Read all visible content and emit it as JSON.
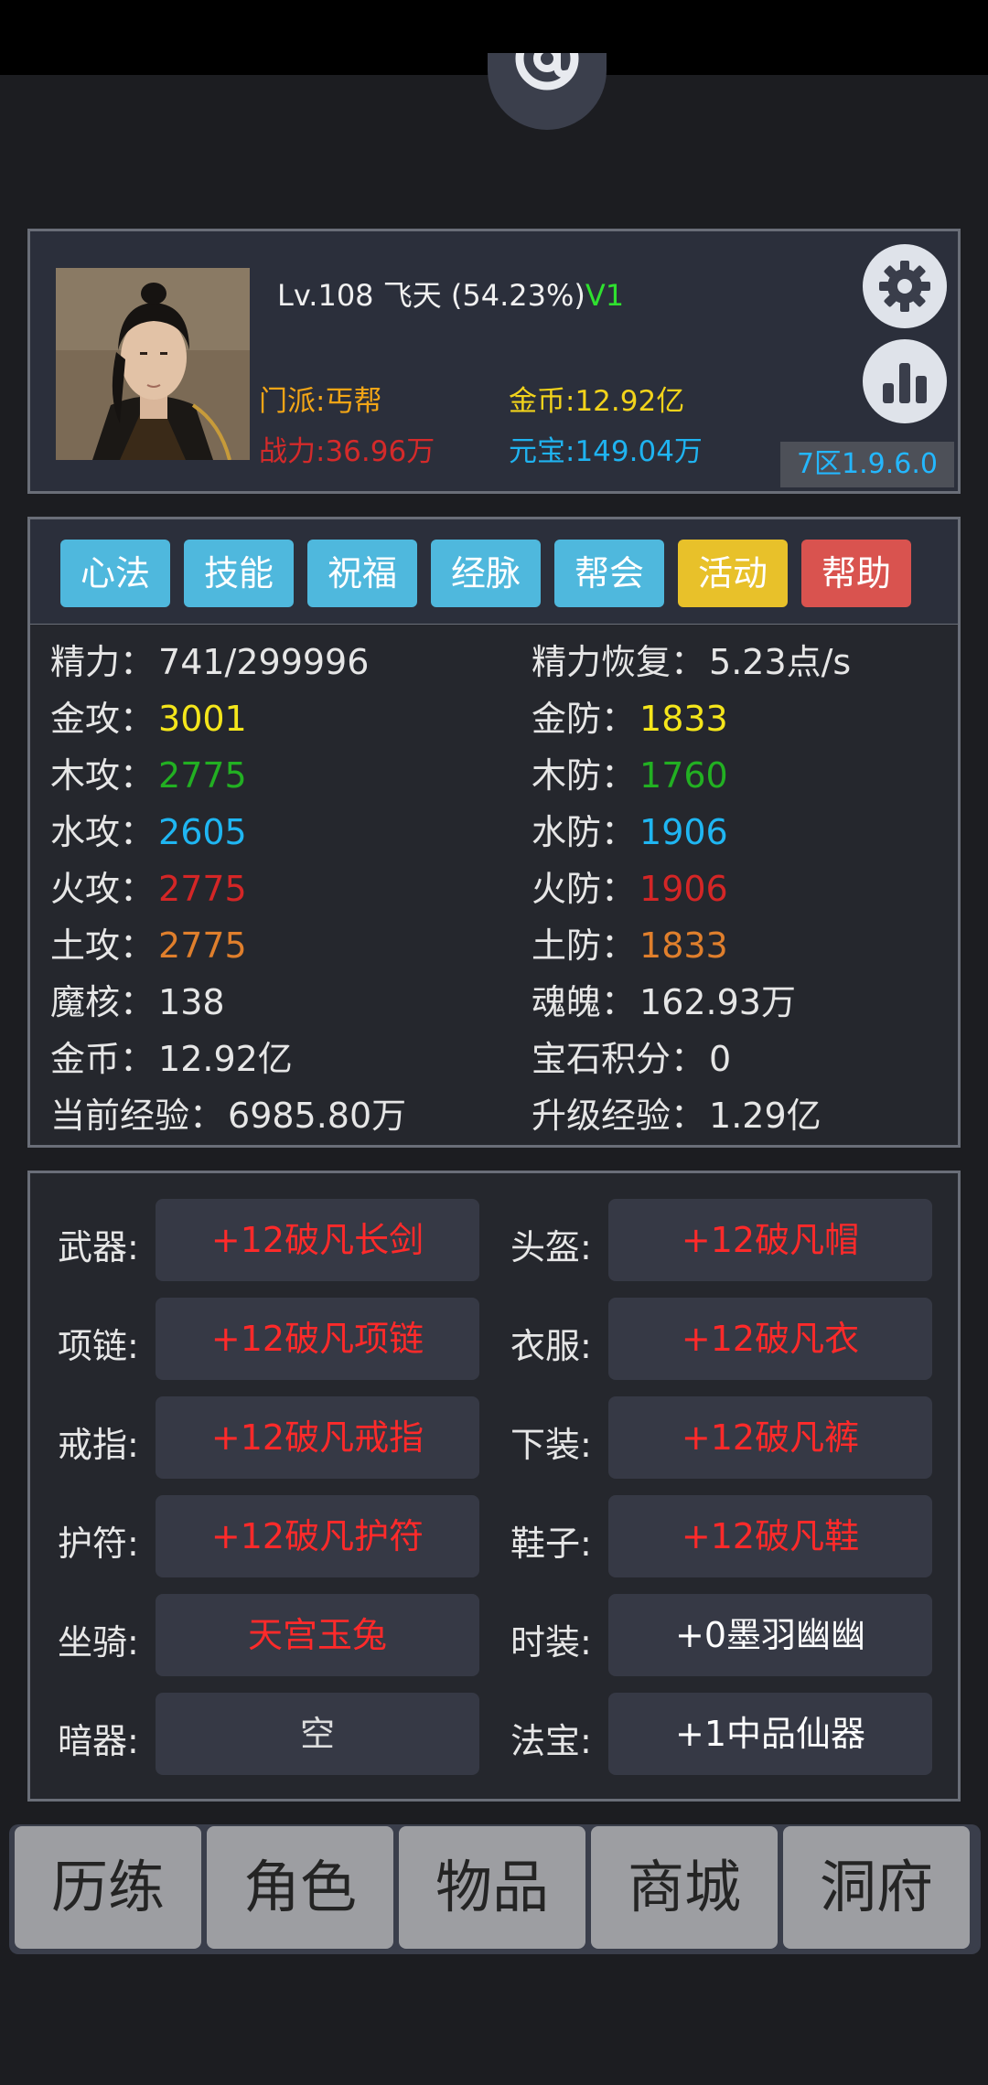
{
  "profile": {
    "level": "Lv.108",
    "name": "飞天",
    "progress": "(54.23%)",
    "vip": "V1",
    "sect": "门派:丐帮",
    "power": "战力:36.96万",
    "gold": "金币:12.92亿",
    "yuanbao": "元宝:149.04万",
    "server": "7区1.9.6.0",
    "icons": [
      "gear-icon",
      "bar-chart-icon",
      "at-icon"
    ]
  },
  "tabs": [
    {
      "label": "心法",
      "color": "#4fb8dd"
    },
    {
      "label": "技能",
      "color": "#4fb8dd"
    },
    {
      "label": "祝福",
      "color": "#4fb8dd"
    },
    {
      "label": "经脉",
      "color": "#4fb8dd"
    },
    {
      "label": "帮会",
      "color": "#4fb8dd"
    },
    {
      "label": "活动",
      "color": "#e8c12a"
    },
    {
      "label": "帮助",
      "color": "#d9534f"
    }
  ],
  "stats": {
    "left": [
      {
        "label": "精力：",
        "value": "741/299996",
        "color": "#e6e6e6"
      },
      {
        "label": "金攻：",
        "value": "3001",
        "color": "#f5e61b"
      },
      {
        "label": "木攻：",
        "value": "2775",
        "color": "#22b022"
      },
      {
        "label": "水攻：",
        "value": "2605",
        "color": "#1fb6f2"
      },
      {
        "label": "火攻：",
        "value": "2775",
        "color": "#d42626"
      },
      {
        "label": "土攻：",
        "value": "2775",
        "color": "#e07f2c"
      },
      {
        "label": "魔核：",
        "value": "138",
        "color": "#e6e6e6"
      },
      {
        "label": "金币：",
        "value": "12.92亿",
        "color": "#e6e6e6"
      },
      {
        "label": "当前经验：",
        "value": "6985.80万",
        "color": "#e6e6e6"
      }
    ],
    "right": [
      {
        "label": "精力恢复：",
        "value": "5.23点/s",
        "color": "#e6e6e6"
      },
      {
        "label": "金防：",
        "value": "1833",
        "color": "#f5e61b"
      },
      {
        "label": "木防：",
        "value": "1760",
        "color": "#22b022"
      },
      {
        "label": "水防：",
        "value": "1906",
        "color": "#1fb6f2"
      },
      {
        "label": "火防：",
        "value": "1906",
        "color": "#d42626"
      },
      {
        "label": "土防：",
        "value": "1833",
        "color": "#e07f2c"
      },
      {
        "label": "魂魄：",
        "value": "162.93万",
        "color": "#e6e6e6"
      },
      {
        "label": "宝石积分：",
        "value": "0",
        "color": "#e6e6e6"
      },
      {
        "label": "升级经验：",
        "value": "1.29亿",
        "color": "#e6e6e6"
      }
    ]
  },
  "equipment": {
    "left": [
      {
        "label": "武器:",
        "item": "+12破凡长剑",
        "color": "#ff2a2a"
      },
      {
        "label": "项链:",
        "item": "+12破凡项链",
        "color": "#ff2a2a"
      },
      {
        "label": "戒指:",
        "item": "+12破凡戒指",
        "color": "#ff2a2a"
      },
      {
        "label": "护符:",
        "item": "+12破凡护符",
        "color": "#ff2a2a"
      },
      {
        "label": "坐骑:",
        "item": "天宫玉兔",
        "color": "#ff2a2a"
      },
      {
        "label": "暗器:",
        "item": "空",
        "color": "#dddddd"
      }
    ],
    "right": [
      {
        "label": "头盔:",
        "item": "+12破凡帽",
        "color": "#ff2a2a"
      },
      {
        "label": "衣服:",
        "item": "+12破凡衣",
        "color": "#ff2a2a"
      },
      {
        "label": "下装:",
        "item": "+12破凡裤",
        "color": "#ff2a2a"
      },
      {
        "label": "鞋子:",
        "item": "+12破凡鞋",
        "color": "#ff2a2a"
      },
      {
        "label": "时装:",
        "item": "+0墨羽幽幽",
        "color": "#ffffff"
      },
      {
        "label": "法宝:",
        "item": "+1中品仙器",
        "color": "#ffffff"
      }
    ]
  },
  "nav": [
    "历练",
    "角色",
    "物品",
    "商城",
    "洞府"
  ]
}
